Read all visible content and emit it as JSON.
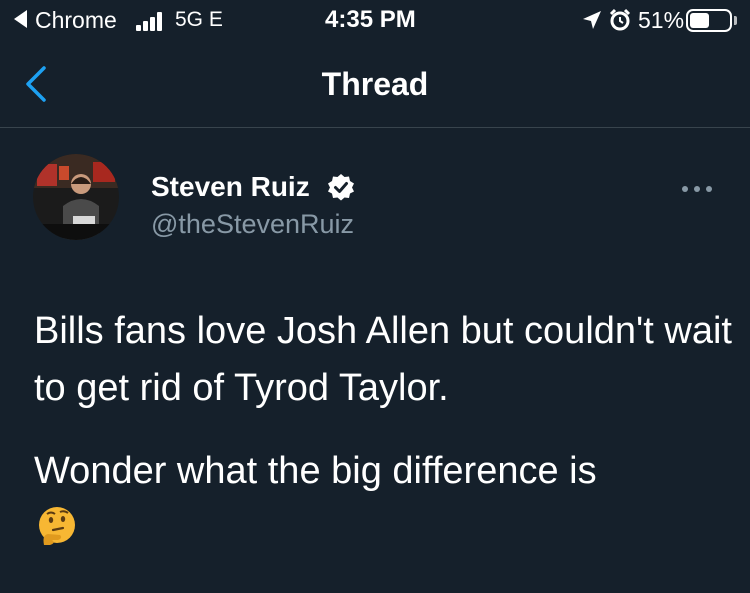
{
  "status_bar": {
    "carrier": "Chrome",
    "network": "5G E",
    "time": "4:35 PM",
    "battery_pct": "51%",
    "battery_level": 0.51
  },
  "nav": {
    "title": "Thread"
  },
  "tweet": {
    "author_name": "Steven Ruiz",
    "author_handle": "@theStevenRuiz",
    "text_paragraph_1": "Bills fans love Josh Allen but couldn't wait to get rid of Tyrod Taylor.",
    "text_paragraph_2": "Wonder what the big difference is",
    "emoji": "thinking-face"
  },
  "colors": {
    "background": "#15202b",
    "accent": "#1da1f2",
    "secondary_text": "#8899a6",
    "divider": "#38444d"
  }
}
